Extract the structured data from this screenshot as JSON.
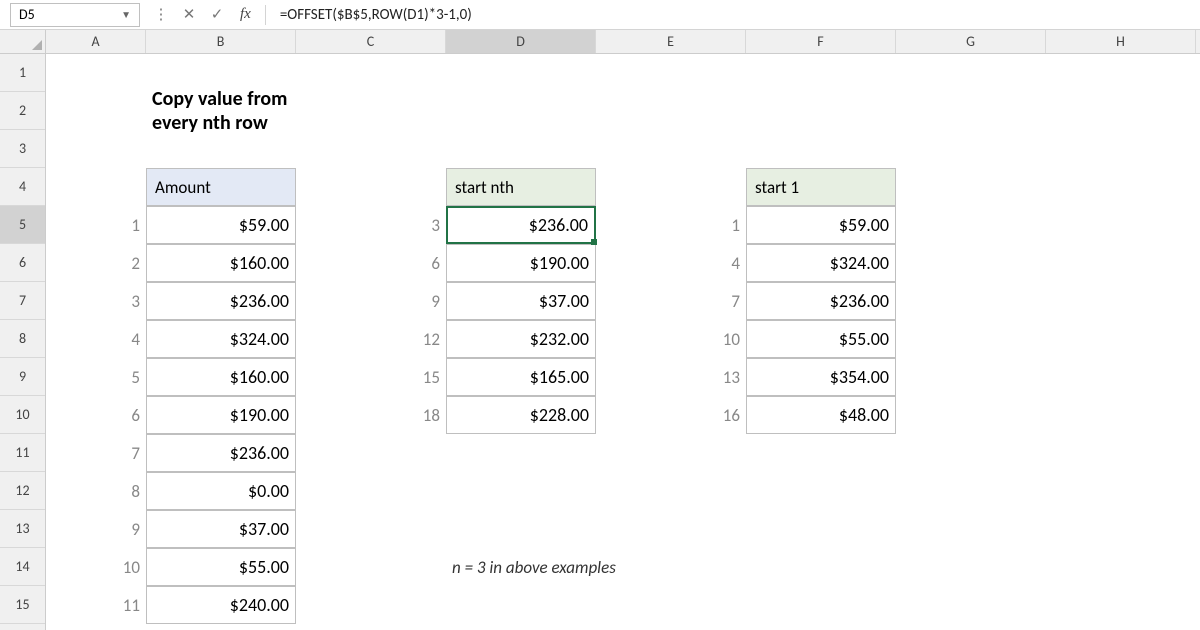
{
  "name_box": "D5",
  "formula": "=OFFSET($B$5,ROW(D1)*3-1,0)",
  "title": "Copy value from every nth row",
  "note": "n = 3 in above examples",
  "columns": [
    "A",
    "B",
    "C",
    "D",
    "E",
    "F",
    "G",
    "H"
  ],
  "rows": [
    "1",
    "2",
    "3",
    "4",
    "5",
    "6",
    "7",
    "8",
    "9",
    "10",
    "11",
    "12",
    "13",
    "14",
    "15"
  ],
  "active_col": "D",
  "active_row": "5",
  "headers": {
    "amount": "Amount",
    "startNth": "start nth",
    "start1": "start 1"
  },
  "amount": {
    "idx": [
      "1",
      "2",
      "3",
      "4",
      "5",
      "6",
      "7",
      "8",
      "9",
      "10",
      "11"
    ],
    "vals": [
      "$59.00",
      "$160.00",
      "$236.00",
      "$324.00",
      "$160.00",
      "$190.00",
      "$236.00",
      "$0.00",
      "$37.00",
      "$55.00",
      "$240.00"
    ]
  },
  "nth": {
    "idx": [
      "3",
      "6",
      "9",
      "12",
      "15",
      "18"
    ],
    "vals": [
      "$236.00",
      "$190.00",
      "$37.00",
      "$232.00",
      "$165.00",
      "$228.00"
    ]
  },
  "one": {
    "idx": [
      "1",
      "4",
      "7",
      "10",
      "13",
      "16"
    ],
    "vals": [
      "$59.00",
      "$324.00",
      "$236.00",
      "$55.00",
      "$354.00",
      "$48.00"
    ]
  }
}
